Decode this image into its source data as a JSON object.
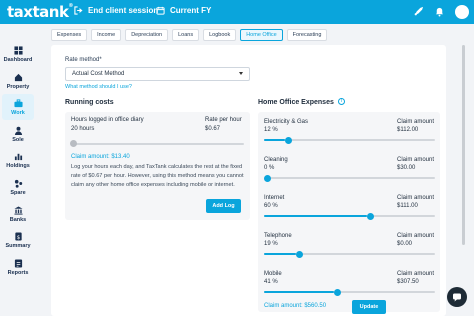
{
  "app": {
    "logo": "taxtank",
    "logo_mark": "®"
  },
  "topbar": {
    "end_session_label": "End client session",
    "fy_label": "Current FY"
  },
  "sidebar": {
    "items": [
      {
        "label": "Dashboard",
        "icon": "dashboard-icon"
      },
      {
        "label": "Property",
        "icon": "house-icon"
      },
      {
        "label": "Work",
        "icon": "briefcase-icon",
        "active": true
      },
      {
        "label": "Sole",
        "icon": "person-icon"
      },
      {
        "label": "Holdings",
        "icon": "chart-icon"
      },
      {
        "label": "Spare",
        "icon": "spare-icon"
      },
      {
        "label": "Banks",
        "icon": "bank-icon"
      },
      {
        "label": "Summary",
        "icon": "dollar-doc-icon"
      },
      {
        "label": "Reports",
        "icon": "reports-icon"
      }
    ]
  },
  "tabs": [
    {
      "label": "Expenses"
    },
    {
      "label": "Income"
    },
    {
      "label": "Depreciation"
    },
    {
      "label": "Loans"
    },
    {
      "label": "Logbook"
    },
    {
      "label": "Home Office",
      "active": true
    },
    {
      "label": "Forecasting"
    }
  ],
  "rate": {
    "label": "Rate method*",
    "selected": "Actual Cost Method",
    "help_link": "What method should I use?"
  },
  "running": {
    "title": "Running costs",
    "hours_header": "Hours logged in office diary",
    "hours_value": "20 hours",
    "rate_header": "Rate per hour",
    "rate_value": "$0.67",
    "claim": "Claim amount: $13.40",
    "description": "Log your hours each day, and TaxTank calculates the rest at the fixed rate of $0.67 per hour. However, using this method means you cannot claim any other home office expenses including mobile or internet.",
    "add_log_label": "Add Log"
  },
  "home_office": {
    "title": "Home Office Expenses",
    "claim_header": "Claim amount",
    "items": [
      {
        "name": "Electricity & Gas",
        "percent": "12 %",
        "amount": "$112.00",
        "fraction": 0.12
      },
      {
        "name": "Cleaning",
        "percent": "0 %",
        "amount": "$30.00",
        "fraction": 0.0
      },
      {
        "name": "Internet",
        "percent": "60 %",
        "amount": "$111.00",
        "fraction": 0.6
      },
      {
        "name": "Telephone",
        "percent": "19 %",
        "amount": "$0.00",
        "fraction": 0.19
      },
      {
        "name": "Mobile",
        "percent": "41 %",
        "amount": "$307.50",
        "fraction": 0.41
      }
    ],
    "claim_total": "Claim amount: $560.50",
    "update_label": "Update"
  },
  "colors": {
    "accent": "#0aa5dc",
    "dark": "#1e2b36"
  }
}
